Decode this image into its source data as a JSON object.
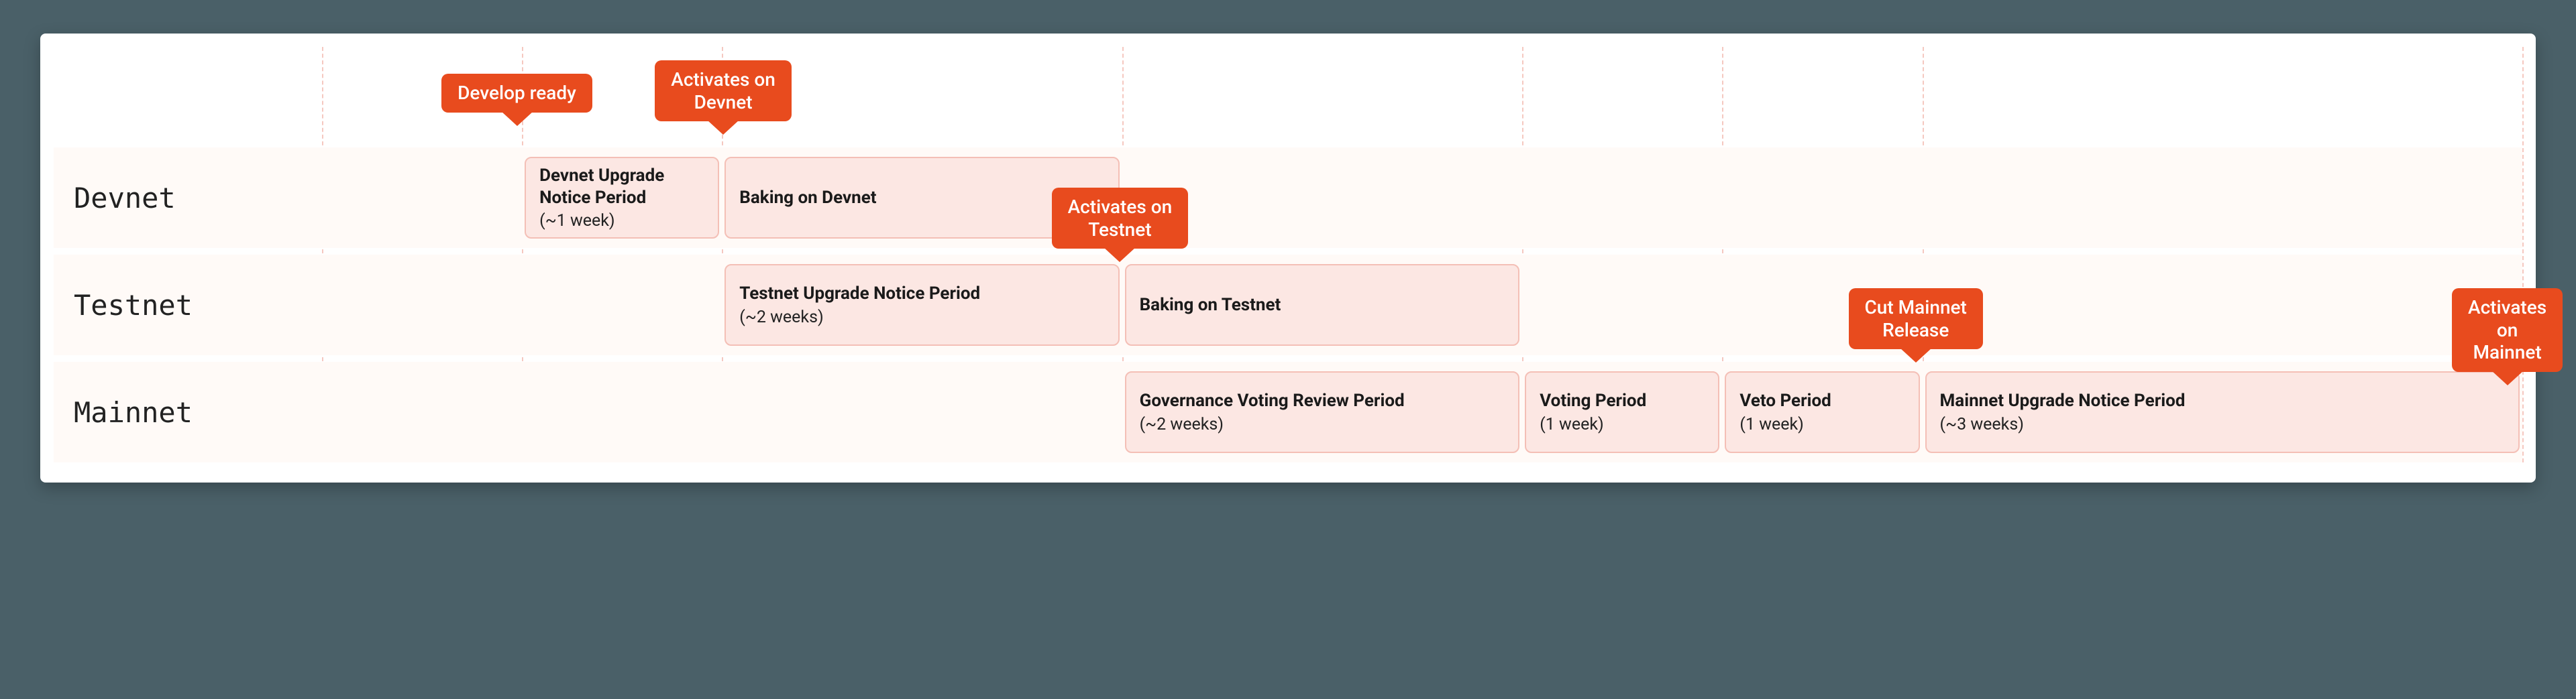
{
  "rows": [
    {
      "id": "devnet",
      "label": "Devnet"
    },
    {
      "id": "testnet",
      "label": "Testnet"
    },
    {
      "id": "mainnet",
      "label": "Mainnet"
    }
  ],
  "markers": {
    "develop_ready": {
      "text": "Develop ready"
    },
    "activates_devnet": {
      "text": "Activates on\nDevnet"
    },
    "activates_testnet": {
      "text": "Activates on\nTestnet"
    },
    "cut_mainnet_release": {
      "text": "Cut Mainnet\nRelease"
    },
    "activates_mainnet": {
      "text": "Activates on\nMainnet"
    }
  },
  "phases": {
    "devnet_notice": {
      "title": "Devnet Upgrade Notice Period",
      "sub": "(~1 week)"
    },
    "devnet_baking": {
      "title": "Baking on Devnet",
      "sub": ""
    },
    "testnet_notice": {
      "title": "Testnet Upgrade Notice Period",
      "sub": "(~2 weeks)"
    },
    "testnet_baking": {
      "title": "Baking on Testnet",
      "sub": ""
    },
    "gov_voting": {
      "title": "Governance Voting Review Period",
      "sub": "(~2 weeks)"
    },
    "voting_period": {
      "title": "Voting Period",
      "sub": "(1 week)"
    },
    "veto_period": {
      "title": "Veto Period",
      "sub": "(1 week)"
    },
    "mainnet_notice": {
      "title": "Mainnet Upgrade Notice Period",
      "sub": "(~3 weeks)"
    }
  },
  "colors": {
    "marker_bg": "#e84b1e",
    "phase_bg": "#fce7e3",
    "phase_border": "#f4bfb6",
    "row_bg": "#fffaf7",
    "grid": "#f5c8c0"
  }
}
